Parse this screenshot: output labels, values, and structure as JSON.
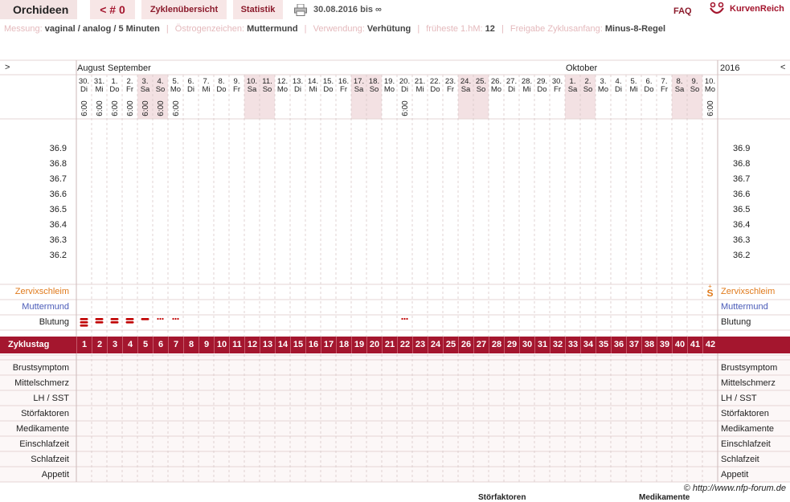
{
  "header": {
    "title": "Orchideen",
    "cycle": "< # 0",
    "tab_overview": "Zyklenübersicht",
    "tab_stats": "Statistik",
    "date_range": "30.08.2016 bis ∞",
    "faq": "FAQ",
    "logo_text": "KurvenReich",
    "print_icon": "printer-icon"
  },
  "info": {
    "measurement_label": "Messung:",
    "measurement_value": "vaginal / analog / 5 Minuten",
    "estrogen_label": "Östrogenzeichen:",
    "estrogen_value": "Muttermund",
    "usage_label": "Verwendung:",
    "usage_value": "Verhütung",
    "earliest_label": "früheste 1.hM:",
    "earliest_value": "12",
    "release_label": "Freigabe Zyklusanfang:",
    "release_value": "Minus-8-Regel"
  },
  "chart": {
    "nav_prev": ">",
    "nav_next": "<",
    "year": "2016",
    "months": [
      "August",
      "September",
      "Oktober"
    ],
    "days": [
      {
        "d": "30.",
        "w": "Di",
        "t": "6:00"
      },
      {
        "d": "31.",
        "w": "Mi",
        "t": "6:00"
      },
      {
        "d": "1.",
        "w": "Do",
        "t": "6:00"
      },
      {
        "d": "2.",
        "w": "Fr",
        "t": "6:00"
      },
      {
        "d": "3.",
        "w": "Sa",
        "t": "6:00",
        "we": true
      },
      {
        "d": "4.",
        "w": "So",
        "t": "6:00",
        "we": true
      },
      {
        "d": "5.",
        "w": "Mo",
        "t": "6:00"
      },
      {
        "d": "6.",
        "w": "Di",
        "t": ""
      },
      {
        "d": "7.",
        "w": "Mi",
        "t": ""
      },
      {
        "d": "8.",
        "w": "Do",
        "t": ""
      },
      {
        "d": "9.",
        "w": "Fr",
        "t": ""
      },
      {
        "d": "10.",
        "w": "Sa",
        "t": "",
        "we": true
      },
      {
        "d": "11.",
        "w": "So",
        "t": "",
        "we": true
      },
      {
        "d": "12.",
        "w": "Mo",
        "t": ""
      },
      {
        "d": "13.",
        "w": "Di",
        "t": ""
      },
      {
        "d": "14.",
        "w": "Mi",
        "t": ""
      },
      {
        "d": "15.",
        "w": "Do",
        "t": ""
      },
      {
        "d": "16.",
        "w": "Fr",
        "t": ""
      },
      {
        "d": "17.",
        "w": "Sa",
        "t": "",
        "we": true
      },
      {
        "d": "18.",
        "w": "So",
        "t": "",
        "we": true
      },
      {
        "d": "19.",
        "w": "Mo",
        "t": ""
      },
      {
        "d": "20.",
        "w": "Di",
        "t": "6:00"
      },
      {
        "d": "21.",
        "w": "Mi",
        "t": ""
      },
      {
        "d": "22.",
        "w": "Do",
        "t": ""
      },
      {
        "d": "23.",
        "w": "Fr",
        "t": ""
      },
      {
        "d": "24.",
        "w": "Sa",
        "t": "",
        "we": true
      },
      {
        "d": "25.",
        "w": "So",
        "t": "",
        "we": true
      },
      {
        "d": "26.",
        "w": "Mo",
        "t": ""
      },
      {
        "d": "27.",
        "w": "Di",
        "t": ""
      },
      {
        "d": "28.",
        "w": "Mi",
        "t": ""
      },
      {
        "d": "29.",
        "w": "Do",
        "t": ""
      },
      {
        "d": "30.",
        "w": "Fr",
        "t": ""
      },
      {
        "d": "1.",
        "w": "Sa",
        "t": "",
        "we": true
      },
      {
        "d": "2.",
        "w": "So",
        "t": "",
        "we": true
      },
      {
        "d": "3.",
        "w": "Mo",
        "t": ""
      },
      {
        "d": "4.",
        "w": "Di",
        "t": ""
      },
      {
        "d": "5.",
        "w": "Mi",
        "t": ""
      },
      {
        "d": "6.",
        "w": "Do",
        "t": ""
      },
      {
        "d": "7.",
        "w": "Fr",
        "t": ""
      },
      {
        "d": "8.",
        "w": "Sa",
        "t": "",
        "we": true
      },
      {
        "d": "9.",
        "w": "So",
        "t": "",
        "we": true
      },
      {
        "d": "10.",
        "w": "Mo",
        "t": "6:00"
      }
    ],
    "temperatures": [
      "36.9",
      "36.8",
      "36.7",
      "36.6",
      "36.5",
      "36.4",
      "36.3",
      "36.2"
    ],
    "cervix_label": "Zervixschleim",
    "cervix_entries": [
      {
        "day": 42,
        "symbol": "S"
      }
    ],
    "mumu_label": "Muttermund",
    "bleeding_label": "Blutung",
    "bleeding": [
      {
        "day": 1,
        "level": "heavy"
      },
      {
        "day": 2,
        "level": "strong"
      },
      {
        "day": 3,
        "level": "strong"
      },
      {
        "day": 4,
        "level": "strong"
      },
      {
        "day": 5,
        "level": "medium"
      },
      {
        "day": 6,
        "level": "spotting"
      },
      {
        "day": 7,
        "level": "spotting"
      },
      {
        "day": 22,
        "level": "spotting"
      }
    ],
    "cycle_day_label": "Zyklustag",
    "bottom_rows": [
      "Brustsymptom",
      "Mittelschmerz",
      "LH / SST",
      "Störfaktoren",
      "Medikamente",
      "Einschlafzeit",
      "Schlafzeit",
      "Appetit"
    ]
  },
  "footer": {
    "copyright": "© http://www.nfp-forum.de",
    "cut_label_1": "Störfaktoren",
    "cut_label_2": "Medikamente"
  },
  "colors": {
    "accent": "#a4162e",
    "weekend": "#f3e1e3",
    "label_pink": "#e4b9bc",
    "cervix": "#e07a1c",
    "mumu": "#4a5bb8"
  }
}
